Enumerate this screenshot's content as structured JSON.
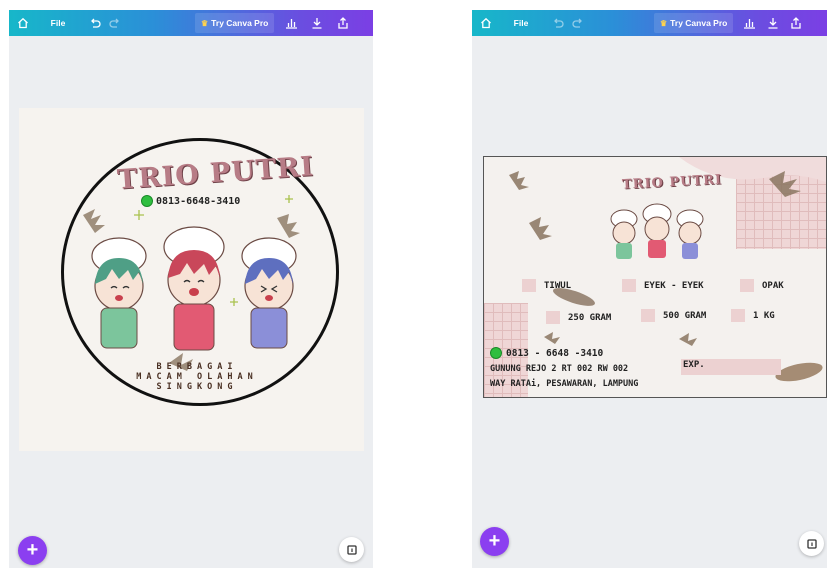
{
  "toolbar": {
    "file_label": "File",
    "pro_label": "Try Canva Pro",
    "icons": [
      "home-icon",
      "undo-icon",
      "redo-icon",
      "crown-icon",
      "chart-icon",
      "download-icon",
      "share-icon"
    ]
  },
  "left_design": {
    "title": "TRIO PUTRI",
    "phone": "0813-6648-3410",
    "tagline": [
      "BERBAGAI",
      "MACAM OLAHAN",
      "SINGKONG"
    ]
  },
  "right_design": {
    "title": "TRIO PUTRI",
    "options": [
      "TIWUL",
      "EYEK - EYEK",
      "OPAK"
    ],
    "weights": [
      "250 GRAM",
      "500 GRAM",
      "1 KG"
    ],
    "phone": "0813 - 6648 -3410",
    "address_line1": "GUNUNG REJO 2 RT 002 RW 002",
    "address_line2": "WAY RATAi, PESAWARAN, LAMPUNG",
    "exp_label": "EXP."
  },
  "fab_label": "+",
  "colors": {
    "toolbar_start": "#17b7c9",
    "toolbar_end": "#7b3fe4",
    "fab": "#8b3ff0",
    "title": "#b77c86",
    "check": "#ecd1d1"
  }
}
